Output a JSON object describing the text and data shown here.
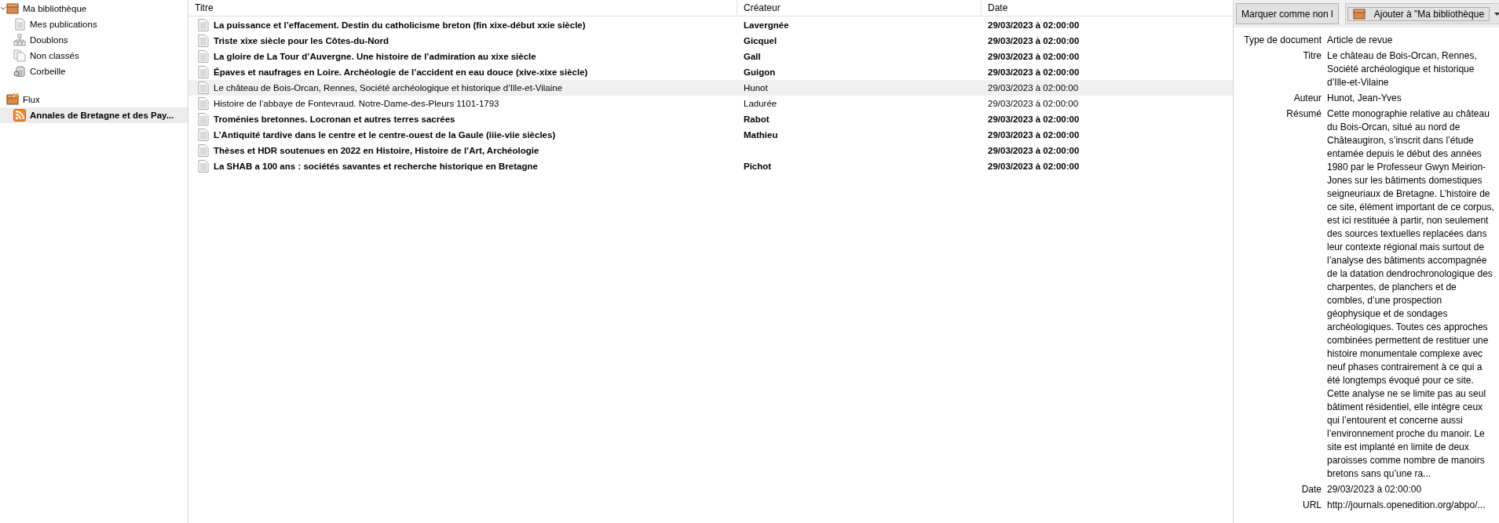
{
  "sidebar": {
    "items": [
      {
        "label": "Ma bibliothèque",
        "kind": "library",
        "expanded": true,
        "selected": false,
        "unread": false,
        "children": [
          {
            "label": "Mes publications",
            "kind": "publications",
            "selected": false,
            "unread": false
          },
          {
            "label": "Doublons",
            "kind": "duplicates",
            "selected": false,
            "unread": false
          },
          {
            "label": "Non classés",
            "kind": "unfiled",
            "selected": false,
            "unread": false
          },
          {
            "label": "Corbeille",
            "kind": "trash",
            "selected": false,
            "unread": false
          }
        ]
      },
      {
        "label": "Flux",
        "kind": "feeds",
        "selected": false,
        "unread": false,
        "children": [
          {
            "label": "Annales de Bretagne et des Pay...",
            "kind": "feed",
            "selected": true,
            "unread": true
          }
        ]
      }
    ]
  },
  "table": {
    "columns": [
      "Titre",
      "Créateur",
      "Date"
    ],
    "rows": [
      {
        "title": "La puissance et l’effacement. Destin du catholicisme breton (fin xixe-début xxie siècle)",
        "creator": "Lavergnée",
        "date": "29/03/2023 à 02:00:00",
        "unread": true,
        "selected": false
      },
      {
        "title": "Triste xixe siècle pour les Côtes-du-Nord",
        "creator": "Gicquel",
        "date": "29/03/2023 à 02:00:00",
        "unread": true,
        "selected": false
      },
      {
        "title": "La gloire de La Tour d’Auvergne. Une histoire de l’admiration au xixe siècle",
        "creator": "Gall",
        "date": "29/03/2023 à 02:00:00",
        "unread": true,
        "selected": false
      },
      {
        "title": "Épaves et naufrages en Loire. Archéologie de l’accident en eau douce (xive-xixe siècle)",
        "creator": "Guigon",
        "date": "29/03/2023 à 02:00:00",
        "unread": true,
        "selected": false
      },
      {
        "title": "Le château de Bois-Orcan, Rennes, Société archéologique et historique d’Ille-et-Vilaine",
        "creator": "Hunot",
        "date": "29/03/2023 à 02:00:00",
        "unread": false,
        "selected": true
      },
      {
        "title": "Histoire de l’abbaye de Fontevraud. Notre-Dame-des-Pleurs 1101-1793",
        "creator": "Ladurée",
        "date": "29/03/2023 à 02:00:00",
        "unread": false,
        "selected": false
      },
      {
        "title": "Troménies bretonnes. Locronan et autres terres sacrées",
        "creator": "Rabot",
        "date": "29/03/2023 à 02:00:00",
        "unread": true,
        "selected": false
      },
      {
        "title": "L’Antiquité tardive dans le centre et le centre-ouest de la Gaule (iiie-viie siècles)",
        "creator": "Mathieu",
        "date": "29/03/2023 à 02:00:00",
        "unread": true,
        "selected": false
      },
      {
        "title": "Thèses et HDR soutenues en 2022 en Histoire, Histoire de l’Art, Archéologie",
        "date": "29/03/2023 à 02:00:00",
        "unread": true,
        "selected": false
      },
      {
        "title": "La SHAB a 100 ans : sociétés savantes et recherche historique en Bretagne",
        "creator": "Pichot",
        "date": "29/03/2023 à 02:00:00",
        "unread": true,
        "selected": false
      }
    ]
  },
  "item_pane": {
    "buttons": [
      {
        "label": "Marquer comme non l",
        "kind": "plain"
      },
      {
        "label": "Ajouter à \"Ma bibliothèque",
        "kind": "menu"
      }
    ],
    "fields": [
      {
        "label": "Type de document",
        "value": "Article de revue"
      },
      {
        "label": "Titre",
        "value": "Le château de Bois-Orcan, Rennes, Société archéologique et historique d’Ille-et-Vilaine"
      },
      {
        "label": "Auteur",
        "value": "Hunot, Jean-Yves"
      },
      {
        "label": "Résumé",
        "value": "Cette monographie relative au château du Bois-Orcan, situé au nord de Châteaugiron, s’inscrit dans l’étude entamée depuis le début des années 1980 par le Professeur Gwyn Meirion-Jones sur les bâtiments domestiques seigneuriaux de Bretagne. L’histoire de ce site, élément important de ce corpus, est ici restituée à partir, non seulement des sources textuelles replacées dans leur contexte régional mais surtout de l’analyse des bâtiments accompagnée de la datation dendrochronologique des charpentes, de planchers et de combles, d’une prospection géophysique et de sondages archéologiques. Toutes ces approches combinées permettent de restituer une histoire monumentale complexe avec neuf phases contrairement à ce qui a été longtemps évoqué pour ce site. Cette analyse ne se limite pas au seul bâtiment résidentiel, elle intègre ceux qui l’entourent et concerne aussi l’environnement proche du manoir. Le site est implanté en limite de deux paroisses comme nombre de manoirs bretons sans qu’une ra..."
      },
      {
        "label": "Date",
        "value": "29/03/2023 à 02:00:00"
      },
      {
        "label": "URL",
        "value": "http://journals.openedition.org/abpo/..."
      }
    ]
  }
}
